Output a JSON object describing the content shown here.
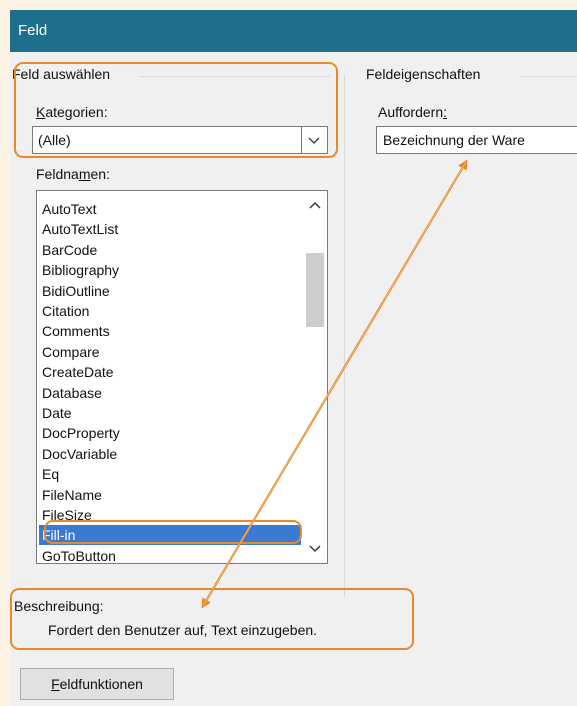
{
  "window": {
    "title": "Feld"
  },
  "select_group": {
    "title": "Feld auswählen",
    "categories_label_key": "K",
    "categories_label_rest": "ategorien:",
    "categories_value": "(Alle)",
    "fieldnames_label_pre": "Feldna",
    "fieldnames_label_key": "m",
    "fieldnames_label_post": "en:",
    "fieldnames": [
      "AutoText",
      "AutoTextList",
      "BarCode",
      "Bibliography",
      "BidiOutline",
      "Citation",
      "Comments",
      "Compare",
      "CreateDate",
      "Database",
      "Date",
      "DocProperty",
      "DocVariable",
      "Eq",
      "FileName",
      "FileSize",
      "Fill-in",
      "GoToButton"
    ],
    "selected_index": 16
  },
  "properties_group": {
    "title": "Feldeigenschaften",
    "prompt_label_pre": "Auffordern",
    "prompt_label_key": ":",
    "prompt_value": "Bezeichnung der Ware"
  },
  "description": {
    "label": "Beschreibung:",
    "text": "Fordert den Benutzer auf, Text einzugeben."
  },
  "buttons": {
    "field_codes_key": "F",
    "field_codes_rest": "eldfunktionen"
  },
  "colors": {
    "titlebar": "#1e6f8c",
    "highlight": "#e88a2a",
    "selection": "#3a7ad2"
  },
  "icons": {
    "combo_arrow": "chevron-down-icon",
    "scroll_up": "chevron-up-icon",
    "scroll_down": "chevron-down-icon"
  }
}
